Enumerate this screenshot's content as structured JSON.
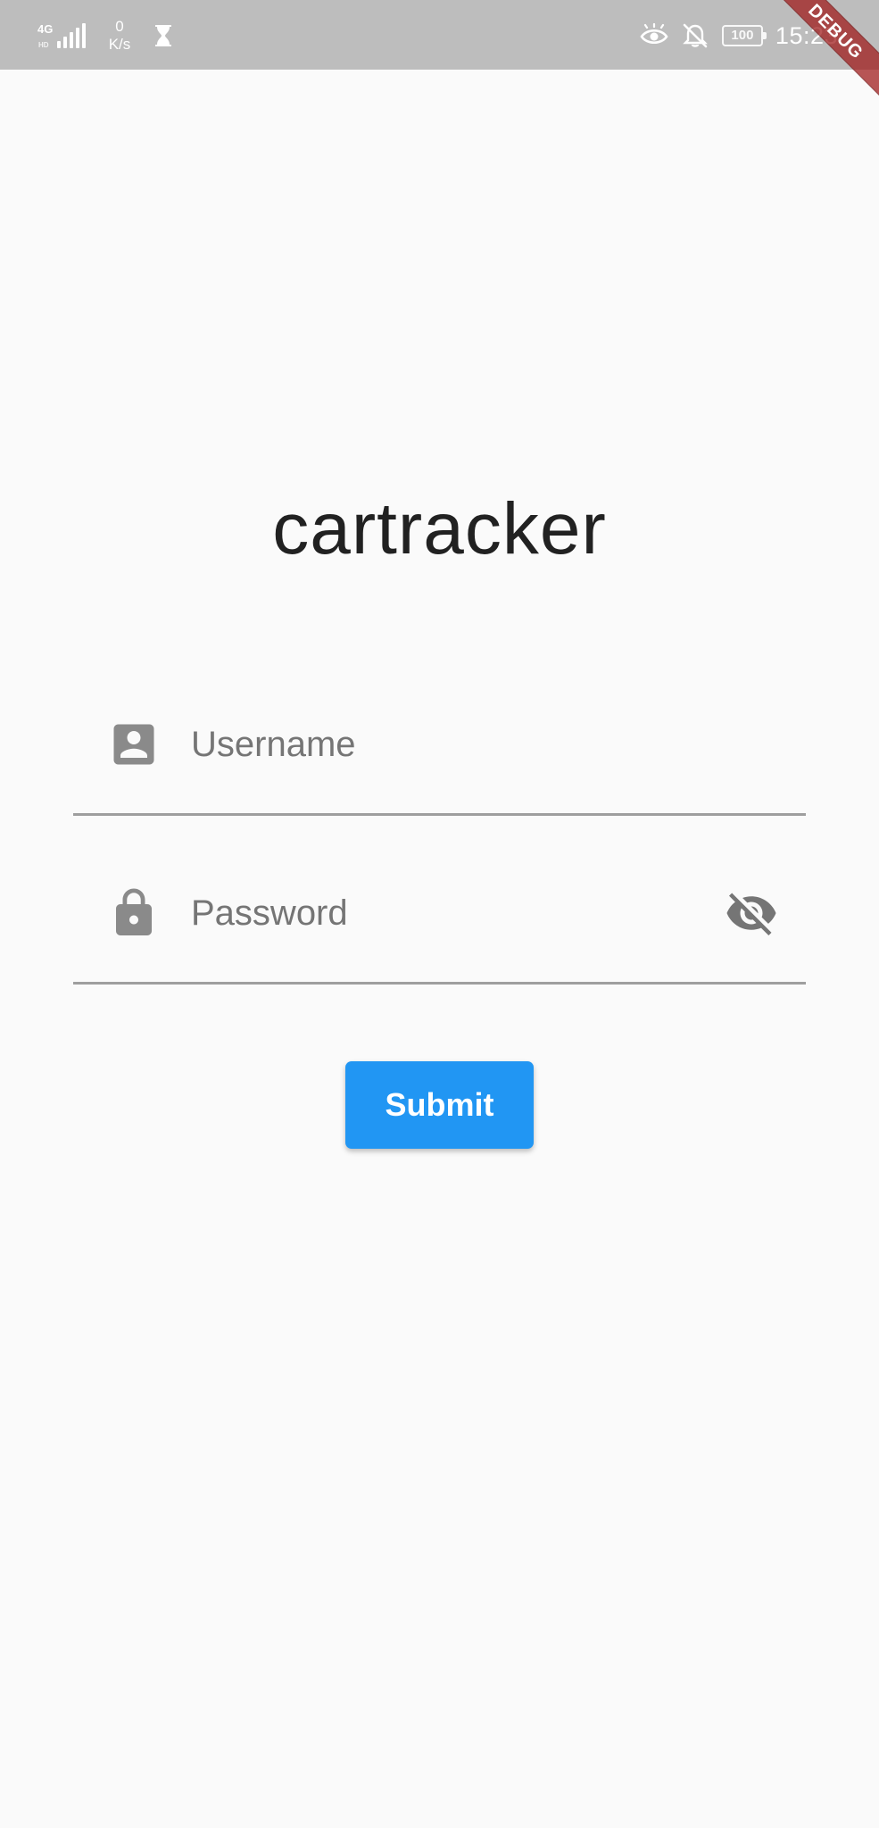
{
  "status_bar": {
    "network_type": "4G",
    "network_sub": "HD",
    "speed_value": "0",
    "speed_unit": "K/s",
    "battery": "100",
    "time": "15:23",
    "icons": [
      "hourglass-icon",
      "eye-comfort-icon",
      "bell-off-icon",
      "battery-icon"
    ],
    "color": "#bdbdbd"
  },
  "debug_banner": "DEBUG",
  "app": {
    "title": "cartracker",
    "username": {
      "placeholder": "Username",
      "value": "",
      "icon": "account-box-icon"
    },
    "password": {
      "placeholder": "Password",
      "value": "",
      "icon": "lock-icon",
      "toggle_icon": "visibility-off-icon"
    },
    "submit_label": "Submit",
    "accent_color": "#2196f3"
  }
}
